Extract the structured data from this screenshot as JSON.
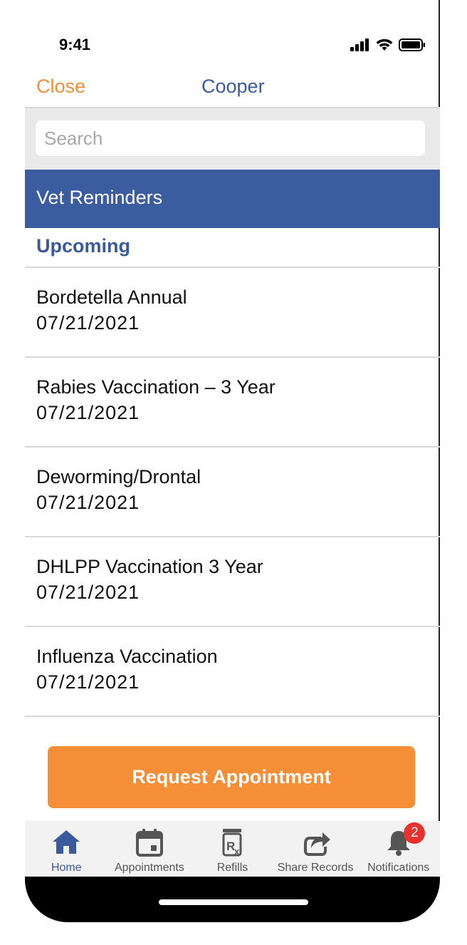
{
  "status_bar": {
    "time": "9:41"
  },
  "nav": {
    "close_label": "Close",
    "title": "Cooper"
  },
  "search": {
    "placeholder": "Search"
  },
  "section": {
    "title": "Vet Reminders",
    "subheading": "Upcoming"
  },
  "reminders": [
    {
      "name": "Bordetella Annual",
      "date": "07/21/2021"
    },
    {
      "name": "Rabies Vaccination – 3 Year",
      "date": "07/21/2021"
    },
    {
      "name": "Deworming/Drontal",
      "date": "07/21/2021"
    },
    {
      "name": "DHLPP Vaccination 3 Year",
      "date": "07/21/2021"
    },
    {
      "name": "Influenza Vaccination",
      "date": "07/21/2021"
    }
  ],
  "actions": {
    "request_label": "Request Appointment"
  },
  "tabs": [
    {
      "label": "Home",
      "icon": "home-icon"
    },
    {
      "label": "Appointments",
      "icon": "calendar-icon"
    },
    {
      "label": "Refills",
      "icon": "prescription-icon"
    },
    {
      "label": "Share Records",
      "icon": "share-icon"
    },
    {
      "label": "Notifications",
      "icon": "bell-icon",
      "badge": "2"
    }
  ],
  "colors": {
    "accent_orange": "#f58f37",
    "brand_blue": "#3b5da0",
    "badge_red": "#e8312f"
  }
}
